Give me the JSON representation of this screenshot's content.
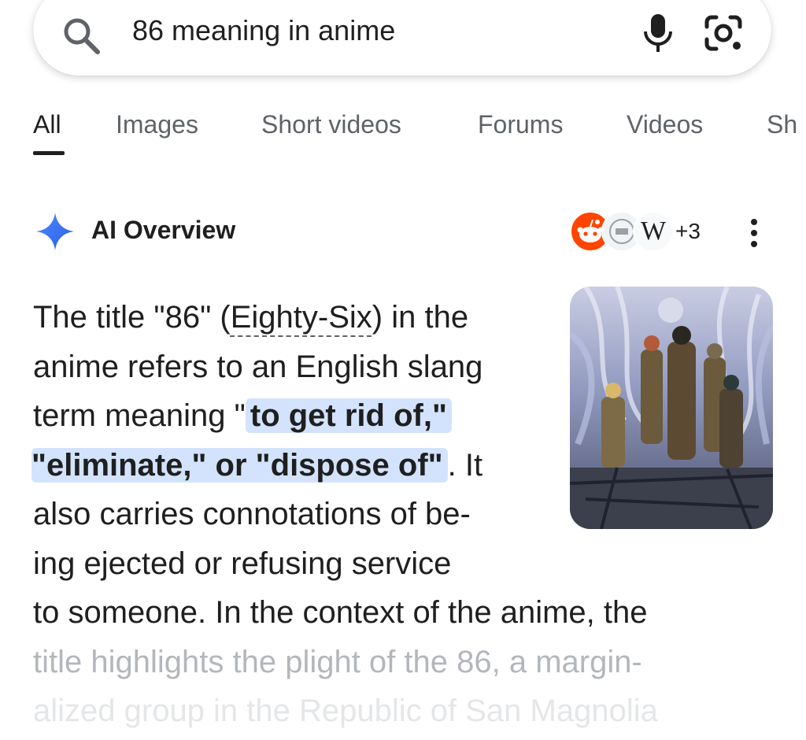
{
  "search": {
    "query": "86 meaning in anime",
    "icon": "search-icon",
    "mic_icon": "mic-icon",
    "lens_icon": "camera-lens-icon"
  },
  "tabs": [
    {
      "label": "All",
      "active": true
    },
    {
      "label": "Images"
    },
    {
      "label": "Short videos"
    },
    {
      "label": "Forums"
    },
    {
      "label": "Videos"
    },
    {
      "label": "Sh"
    }
  ],
  "ai_overview": {
    "title": "AI Overview",
    "sources_more": "+3",
    "wiki_glyph": "W",
    "text": {
      "l1_a": "The title \"86\" (",
      "l1_term": "Eighty-Six",
      "l1_b": ") in the",
      "l2": "anime refers to an English slang",
      "l3_a": "term meaning \"",
      "l3_hl": "to get rid of,\"",
      "l4_hl": "\"eliminate,\" or \"dispose of\"",
      "l4_b": ". It",
      "l5": "also carries connotations of be-",
      "l6": "ing ejected or refusing service",
      "l7": "to someone. In the context of the anime, the",
      "l8": "title highlights the plight of the 86, a margin-",
      "l9": "alized group in the Republic of San Magnolia"
    },
    "accent_color": "#d3e3fd"
  }
}
